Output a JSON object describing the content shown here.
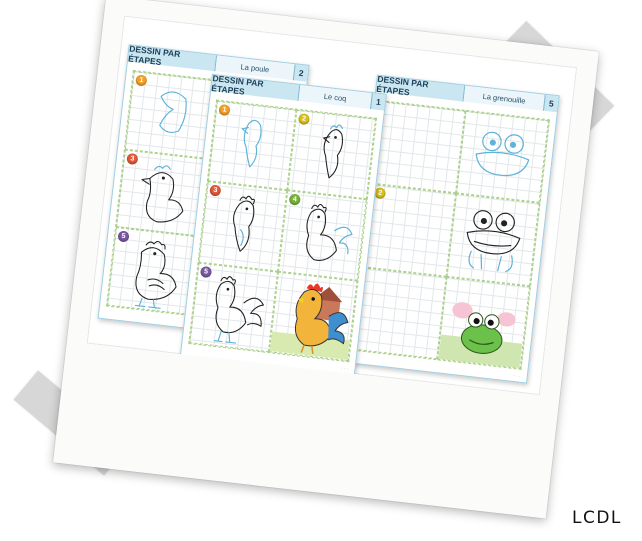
{
  "sheets": [
    {
      "title": "DESSIN PAR ÉTAPES",
      "subject": "La poule",
      "number": "2",
      "steps": [
        "1",
        "3",
        "5"
      ]
    },
    {
      "title": "DESSIN PAR ÉTAPES",
      "subject": "Le coq",
      "number": "1",
      "steps": [
        "1",
        "2",
        "3",
        "4",
        "5"
      ]
    },
    {
      "title": "DESSIN PAR ÉTAPES",
      "subject": "La grenouille",
      "number": "5",
      "steps": [
        "2"
      ]
    }
  ],
  "watermark": "LCDL"
}
